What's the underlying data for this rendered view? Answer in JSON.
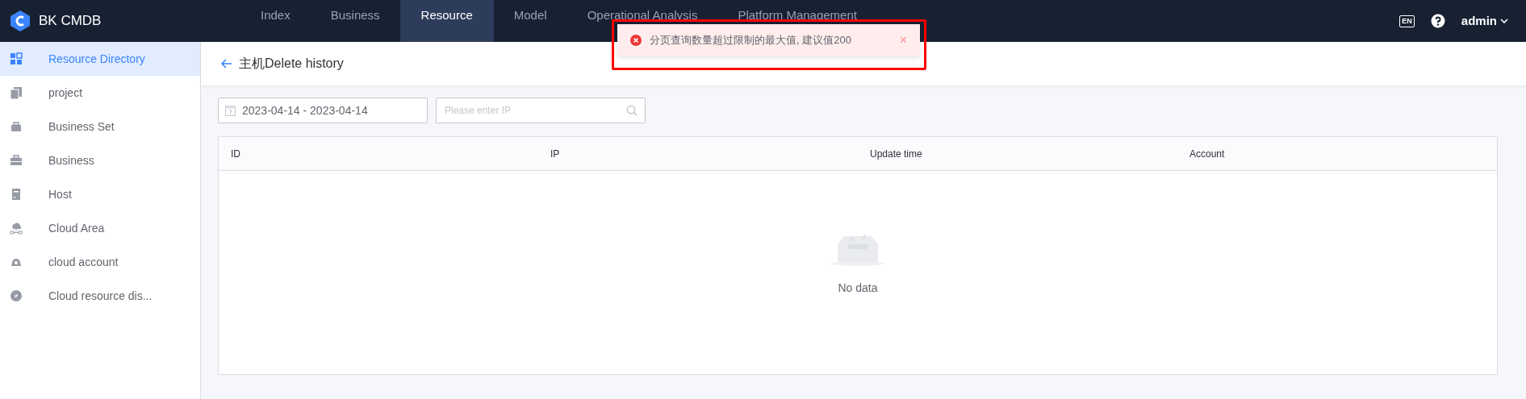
{
  "app": {
    "name": "BK CMDB"
  },
  "nav": [
    {
      "label": "Index",
      "selected": false
    },
    {
      "label": "Business",
      "selected": false
    },
    {
      "label": "Resource",
      "selected": true
    },
    {
      "label": "Model",
      "selected": false
    },
    {
      "label": "Operational Analysis",
      "selected": false
    },
    {
      "label": "Platform Management",
      "selected": false
    }
  ],
  "header_right": {
    "language": "EN",
    "user": "admin"
  },
  "sidebar": {
    "items": [
      {
        "kind": "grid",
        "label": "Resource Directory",
        "selected": true
      },
      {
        "kind": "stack",
        "label": "project",
        "selected": false
      },
      {
        "kind": "bag",
        "label": "Business Set",
        "selected": false
      },
      {
        "kind": "briefcase",
        "label": "Business",
        "selected": false
      },
      {
        "kind": "server",
        "label": "Host",
        "selected": false
      },
      {
        "kind": "cloud",
        "label": "Cloud Area",
        "selected": false
      },
      {
        "kind": "account",
        "label": "cloud account",
        "selected": false
      },
      {
        "kind": "compass",
        "label": "Cloud resource dis...",
        "selected": false
      }
    ]
  },
  "page": {
    "title": "主机Delete history"
  },
  "filters": {
    "date_range": "2023-04-14 - 2023-04-14",
    "ip_placeholder": "Please enter IP"
  },
  "table": {
    "columns": [
      "ID",
      "IP",
      "Update time",
      "Account"
    ],
    "empty_text": "No data"
  },
  "toast": {
    "message": "分页查询数量超过限制的最大值, 建议值200",
    "close": "×"
  }
}
